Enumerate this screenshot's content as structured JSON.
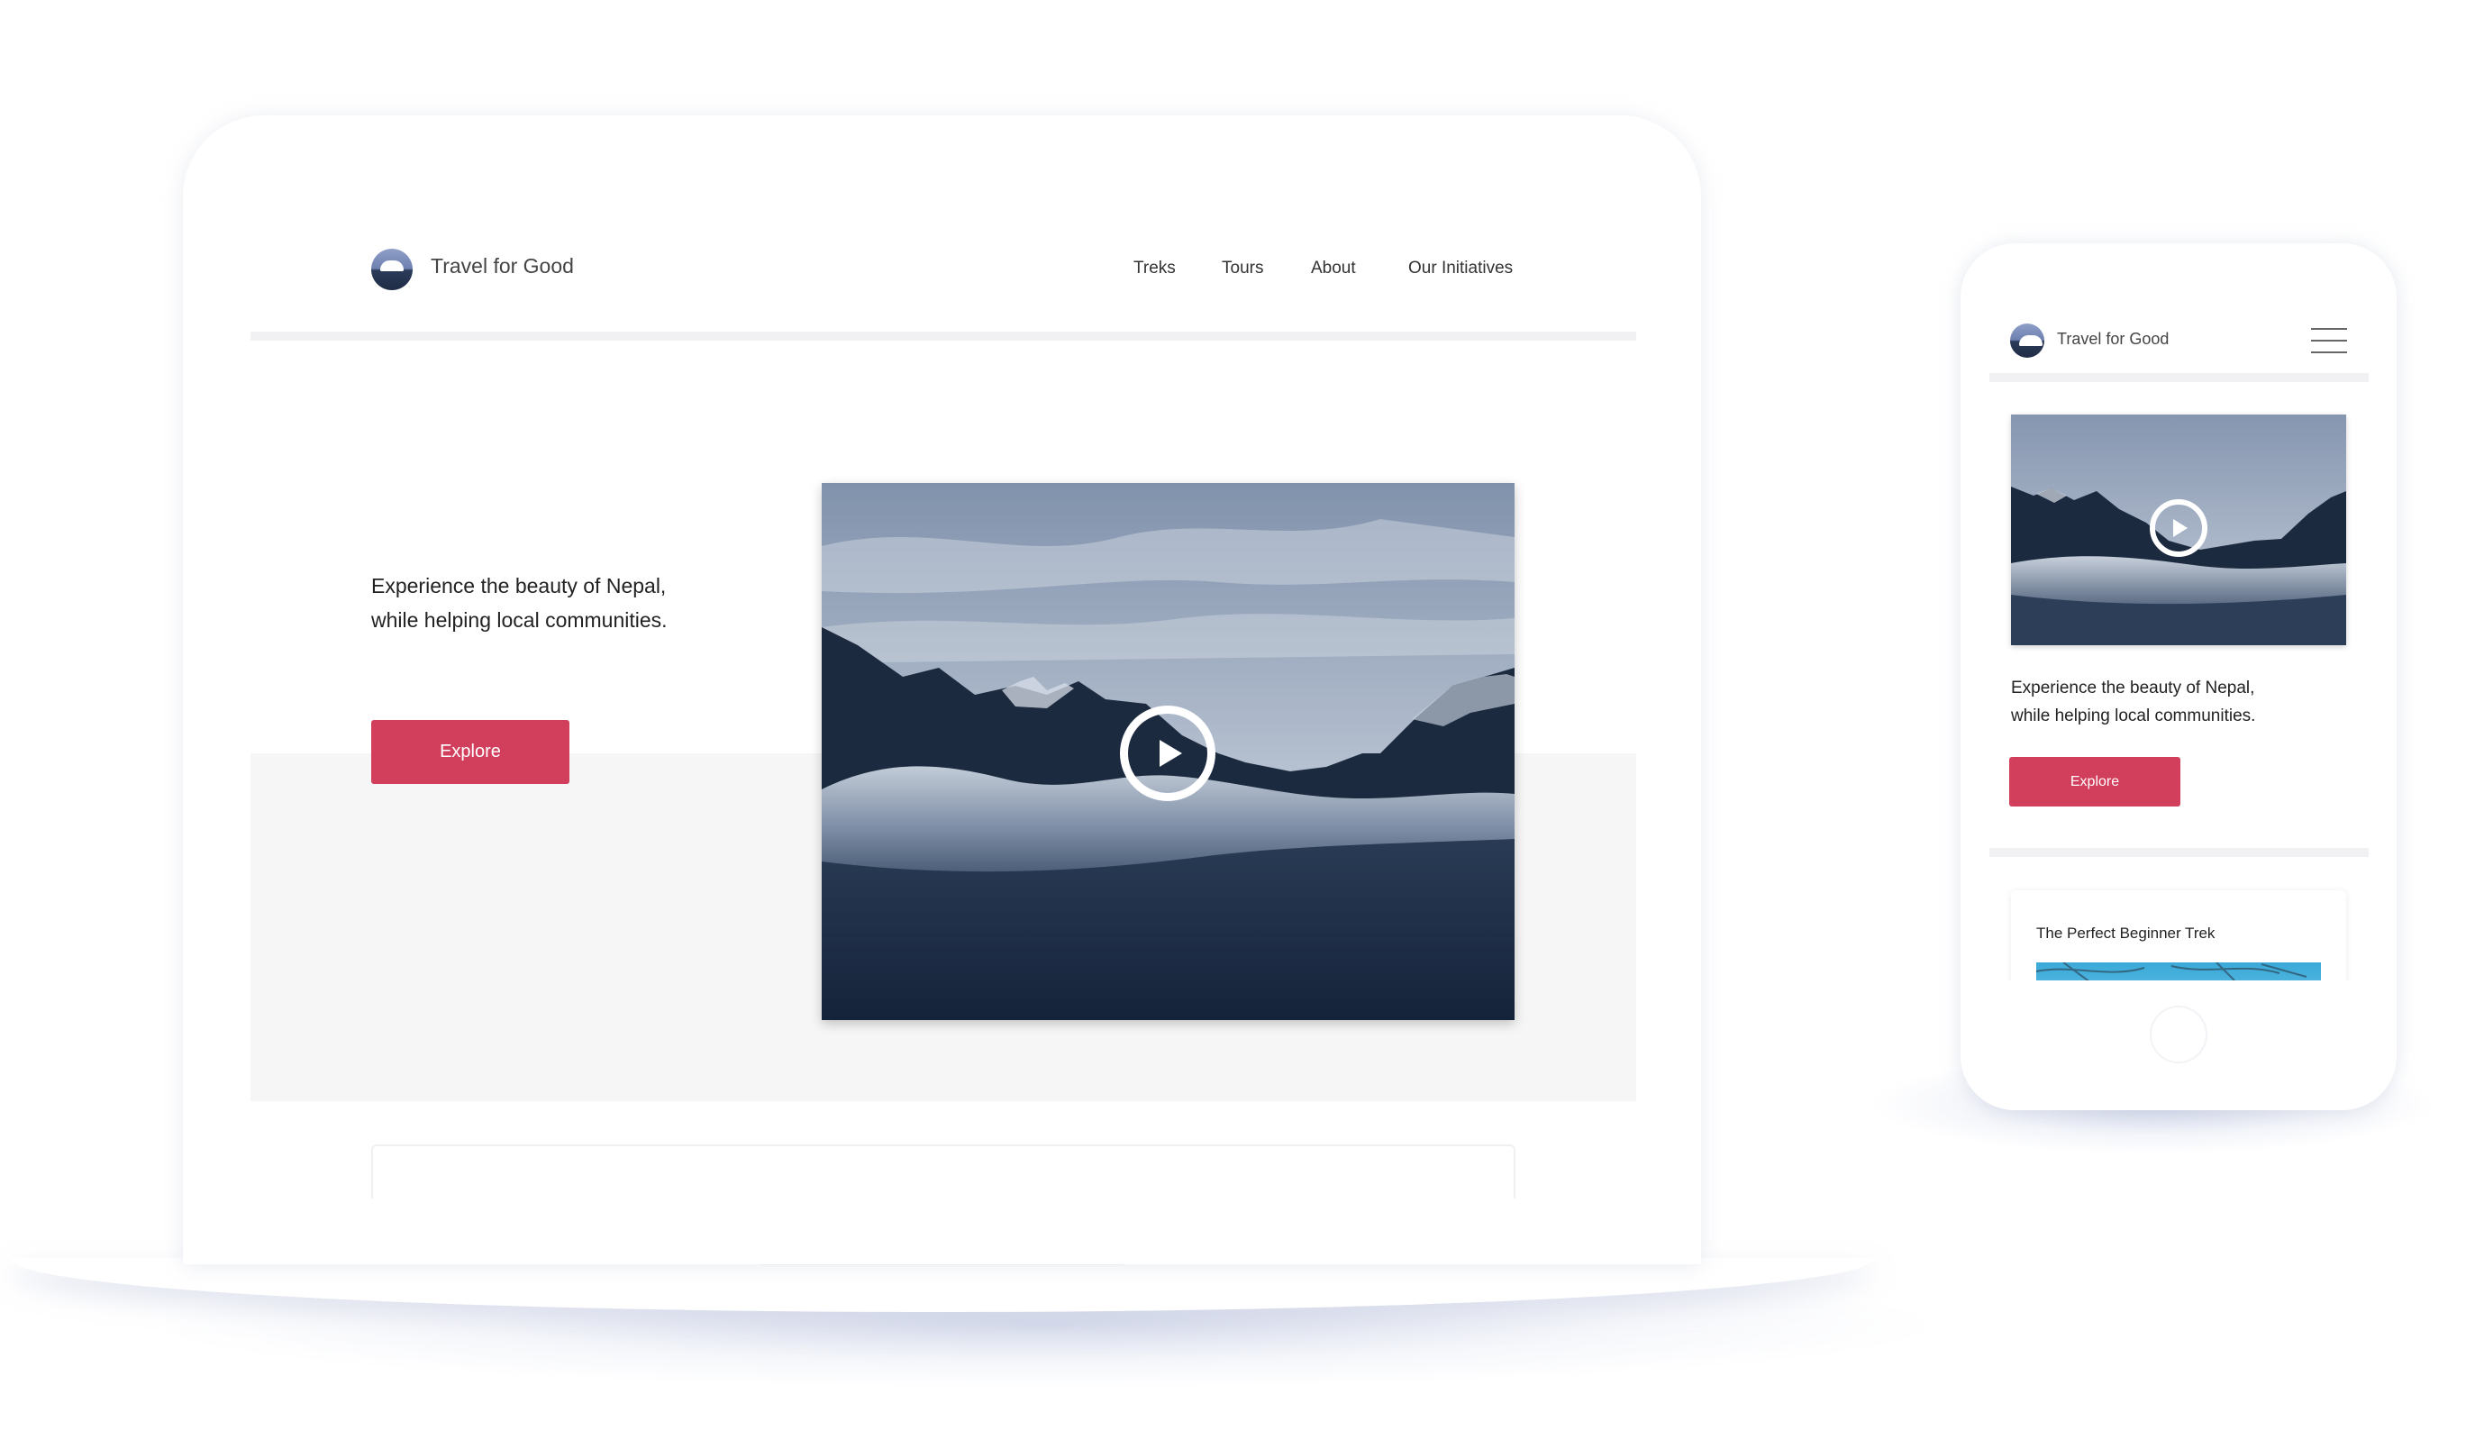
{
  "brand": {
    "name": "Travel for Good"
  },
  "nav": {
    "items": [
      {
        "label": "Treks"
      },
      {
        "label": "Tours"
      },
      {
        "label": "About"
      },
      {
        "label": "Our Initiatives"
      }
    ]
  },
  "hero": {
    "tagline_line1": "Experience the beauty of Nepal,",
    "tagline_line2": "while helping local communities.",
    "cta_label": "Explore"
  },
  "mobile": {
    "card_title": "The Perfect Beginner Trek"
  },
  "colors": {
    "accent": "#d23f5c",
    "hero_background": "#f6f6f6",
    "video_dark": "#1e2e45"
  },
  "icons": {
    "logo": "mountain-logo-icon",
    "play": "play-icon",
    "menu": "hamburger-menu-icon"
  }
}
